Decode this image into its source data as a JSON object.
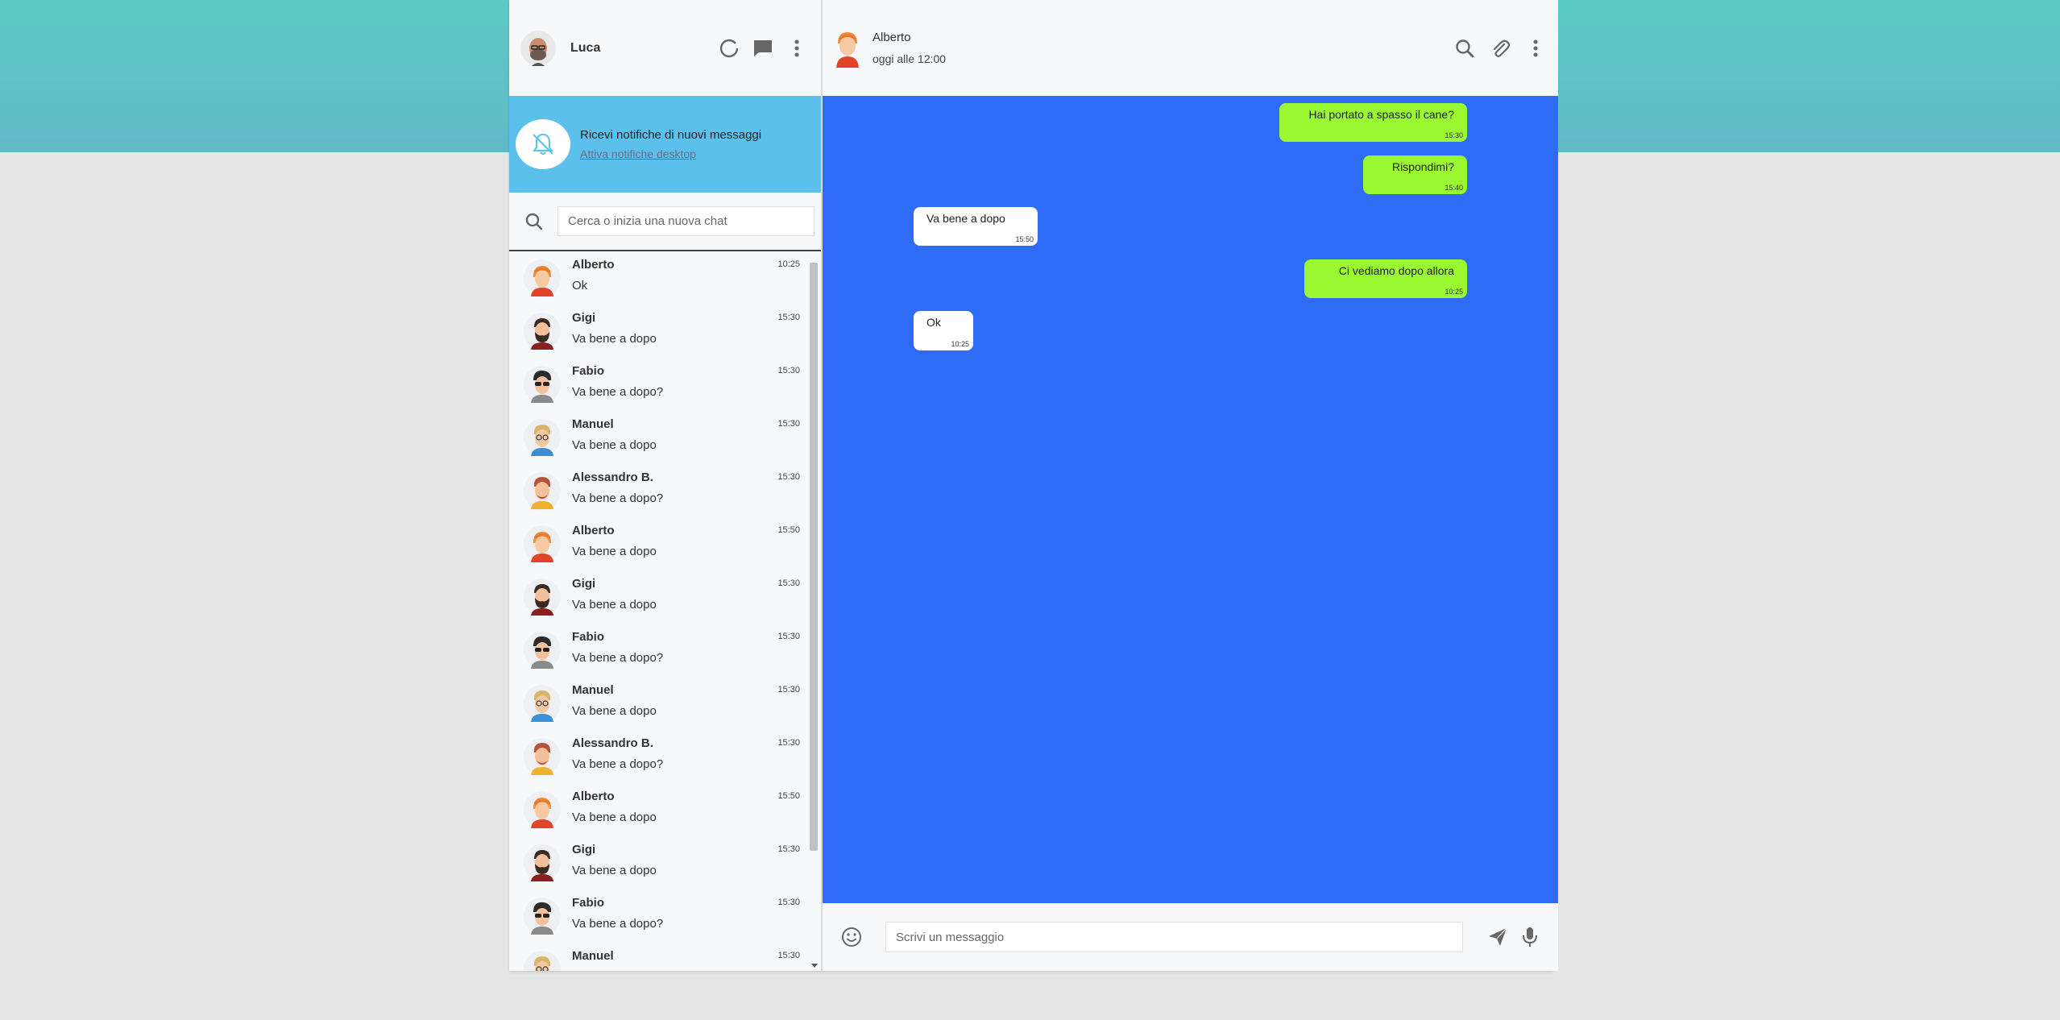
{
  "user": {
    "name": "Luca"
  },
  "notifications": {
    "title": "Ricevi notifiche di nuovi messaggi",
    "link": "Attiva notifiche desktop"
  },
  "search": {
    "placeholder": "Cerca o inizia una nuova chat"
  },
  "chats": [
    {
      "name": "Alberto",
      "time": "10:25",
      "preview": "Ok",
      "avatar": "avatar-alberto"
    },
    {
      "name": "Gigi",
      "time": "15:30",
      "preview": "Va bene a dopo",
      "avatar": "avatar-gigi"
    },
    {
      "name": "Fabio",
      "time": "15:30",
      "preview": "Va bene a dopo?",
      "avatar": "avatar-fabio"
    },
    {
      "name": "Manuel",
      "time": "15:30",
      "preview": "Va bene a dopo",
      "avatar": "avatar-manuel"
    },
    {
      "name": "Alessandro B.",
      "time": "15:30",
      "preview": "Va bene a dopo?",
      "avatar": "avatar-alessandro"
    },
    {
      "name": "Alberto",
      "time": "15:50",
      "preview": "Va bene a dopo",
      "avatar": "avatar-alberto"
    },
    {
      "name": "Gigi",
      "time": "15:30",
      "preview": "Va bene a dopo",
      "avatar": "avatar-gigi"
    },
    {
      "name": "Fabio",
      "time": "15:30",
      "preview": "Va bene a dopo?",
      "avatar": "avatar-fabio"
    },
    {
      "name": "Manuel",
      "time": "15:30",
      "preview": "Va bene a dopo",
      "avatar": "avatar-manuel"
    },
    {
      "name": "Alessandro B.",
      "time": "15:30",
      "preview": "Va bene a dopo?",
      "avatar": "avatar-alessandro"
    },
    {
      "name": "Alberto",
      "time": "15:50",
      "preview": "Va bene a dopo",
      "avatar": "avatar-alberto"
    },
    {
      "name": "Gigi",
      "time": "15:30",
      "preview": "Va bene a dopo",
      "avatar": "avatar-gigi"
    },
    {
      "name": "Fabio",
      "time": "15:30",
      "preview": "Va bene a dopo?",
      "avatar": "avatar-fabio"
    },
    {
      "name": "Manuel",
      "time": "15:30",
      "preview": "",
      "avatar": "avatar-manuel"
    }
  ],
  "conversation": {
    "name": "Alberto",
    "status": "oggi alle 12:00",
    "messages": [
      {
        "text": "Hai portato a spasso il cane?",
        "time": "15:30",
        "direction": "sent"
      },
      {
        "text": "Rispondimi?",
        "time": "15:40",
        "direction": "sent"
      },
      {
        "text": "Va bene a dopo",
        "time": "15:50",
        "direction": "received"
      },
      {
        "text": "Ci vediamo dopo allora",
        "time": "10:25",
        "direction": "sent"
      },
      {
        "text": "Ok",
        "time": "10:25",
        "direction": "received"
      }
    ]
  },
  "composer": {
    "placeholder": "Scrivi un messaggio"
  },
  "colors": {
    "top_band": "#5ccbc6",
    "notify_bg": "#5bc1ec",
    "chat_bg": "#2f6cf6",
    "sent_bubble": "#9af931",
    "received_bubble": "#ffffff"
  }
}
